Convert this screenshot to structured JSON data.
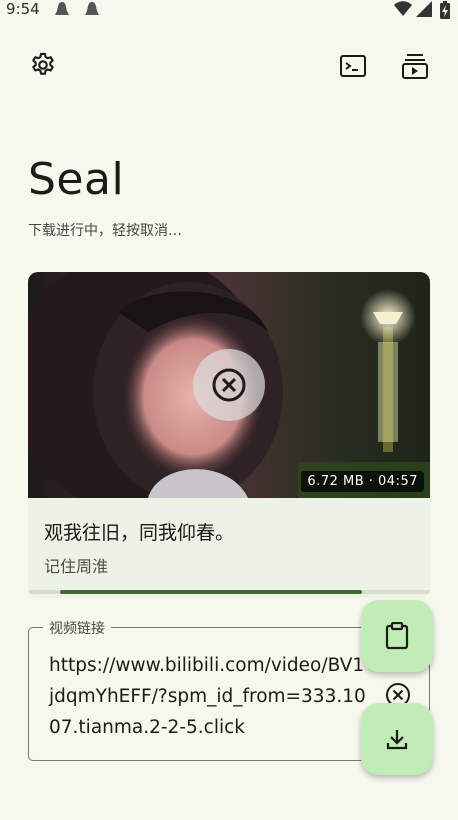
{
  "status_bar": {
    "time": "9:54",
    "icons": [
      "notification-icon",
      "notification-icon",
      "wifi-icon",
      "signal-icon",
      "battery-icon"
    ]
  },
  "toolbar": {
    "left_icon": "gear-icon",
    "right_icons": [
      "terminal-icon",
      "playlist-icon"
    ]
  },
  "app_title": "Seal",
  "status_message": "下载进行中，轻按取消…",
  "video_card": {
    "size_duration": "6.72 MB · 04:57",
    "title": "观我往旧，同我仰春。",
    "author": "记住周淮",
    "progress": 0.76,
    "cancel_icon": "cancel-circle-icon"
  },
  "url_field": {
    "label": "视频链接",
    "value": "https://www.bilibili.com/video/BV1jdqmYhEFF/?spm_id_from=333.1007.tianma.2-2-5.click",
    "clear_icon": "clear-icon"
  },
  "fabs": {
    "paste_icon": "clipboard-icon",
    "download_icon": "download-icon"
  },
  "colors": {
    "background": "#f6f8ee",
    "accent": "#3f6b35",
    "fab": "#c2ecb6"
  }
}
